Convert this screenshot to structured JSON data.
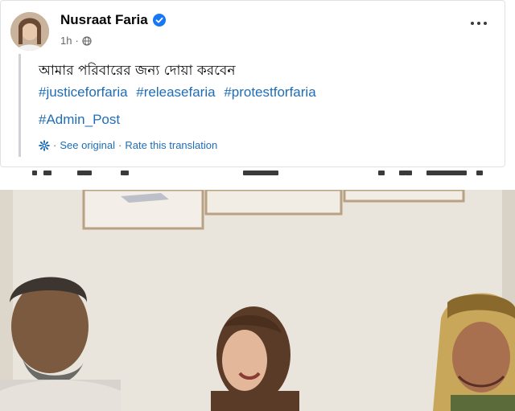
{
  "post": {
    "author_name": "Nusraat Faria",
    "time": "1h",
    "privacy_icon": "globe-icon",
    "text": "আমার পরিবারের জন্য দোয়া করবেন",
    "hashtags": [
      "#justiceforfaria",
      "#releasefaria",
      "#protestforfaria"
    ],
    "admin_tag": "#Admin_Post",
    "see_original": "See original",
    "separator": "·",
    "rate_translation": "Rate this translation"
  },
  "colors": {
    "link": "#1f6db5",
    "verified": "#1877f2",
    "muted": "#65676b"
  }
}
